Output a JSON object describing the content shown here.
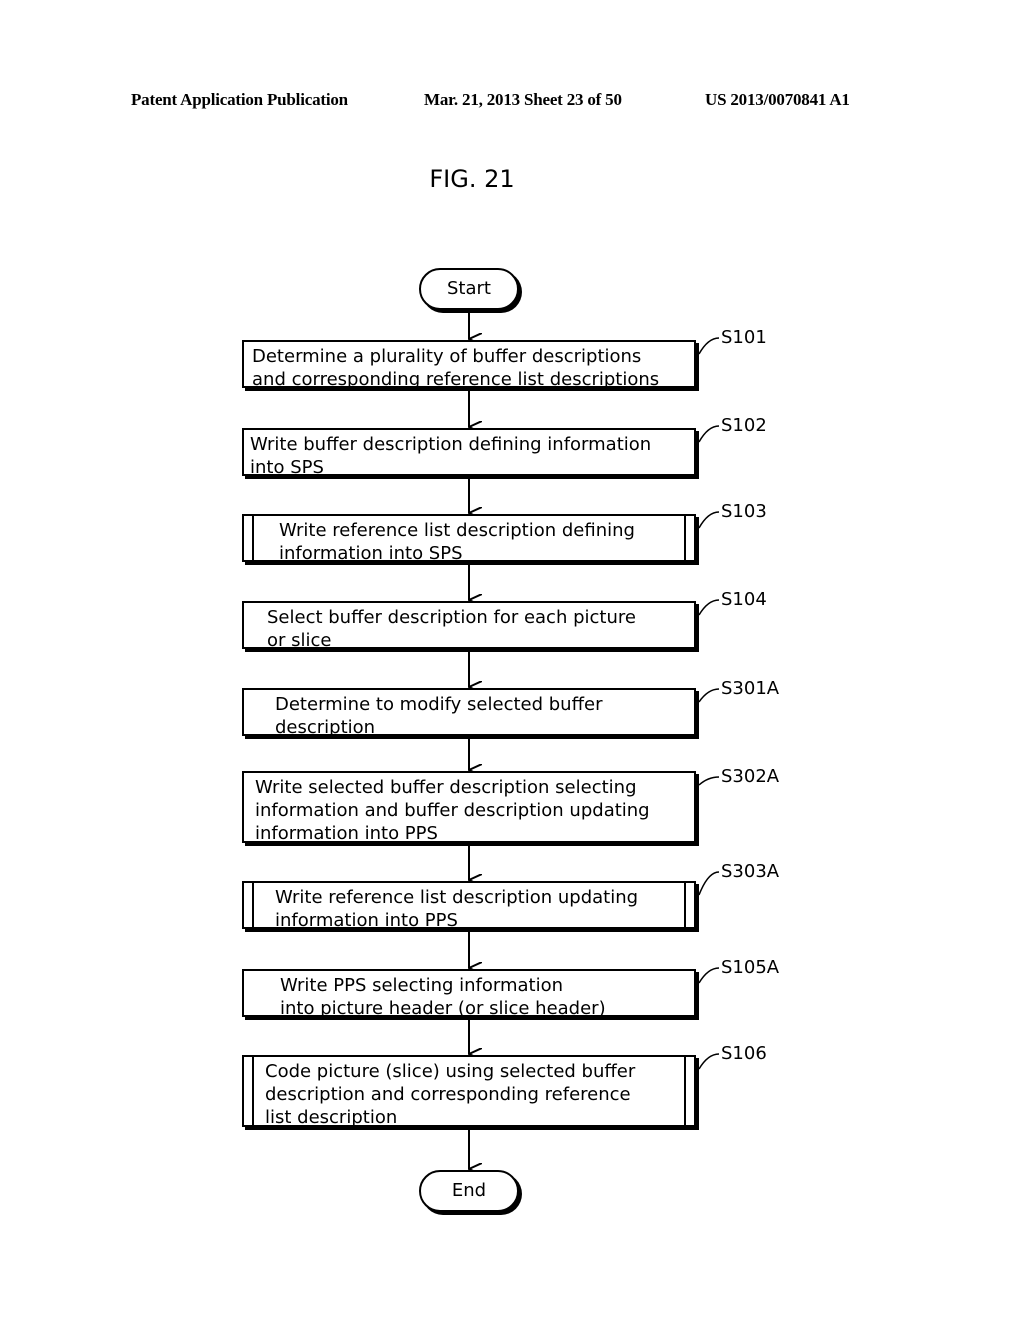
{
  "header": {
    "publication": "Patent Application Publication",
    "date_sheet": "Mar. 21, 2013  Sheet 23 of 50",
    "number": "US 2013/0070841 A1"
  },
  "figure": {
    "title": "FIG. 21",
    "start": "Start",
    "end": "End",
    "steps": [
      {
        "id": "S101",
        "text": "Determine a plurality of buffer descriptions\nand corresponding reference list descriptions",
        "type": "process"
      },
      {
        "id": "S102",
        "text": "Write buffer description defining information\ninto SPS",
        "type": "process"
      },
      {
        "id": "S103",
        "text": "Write reference list description defining\ninformation into SPS",
        "type": "subroutine"
      },
      {
        "id": "S104",
        "text": "Select buffer description for each picture\nor slice",
        "type": "process"
      },
      {
        "id": "S301A",
        "text": "Determine to modify selected buffer\ndescription",
        "type": "process"
      },
      {
        "id": "S302A",
        "text": "Write selected buffer description selecting\ninformation and buffer description updating\ninformation into PPS",
        "type": "process"
      },
      {
        "id": "S303A",
        "text": "Write reference list description updating\ninformation into PPS",
        "type": "subroutine"
      },
      {
        "id": "S105A",
        "text": "Write PPS selecting information\ninto picture header (or slice header)",
        "type": "process"
      },
      {
        "id": "S106",
        "text": "Code picture (slice) using selected buffer\ndescription and corresponding reference\nlist description",
        "type": "subroutine"
      }
    ]
  }
}
